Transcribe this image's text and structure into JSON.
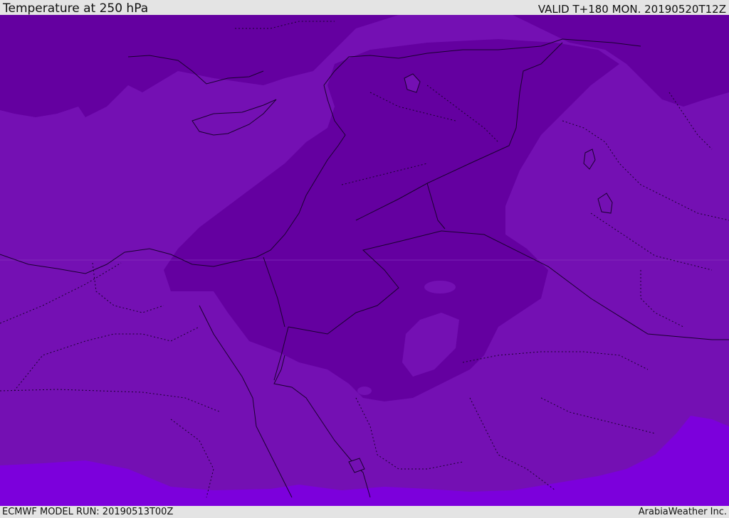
{
  "header": {
    "title": "Temperature at 250 hPa",
    "valid": "VALID T+180 MON. 20190520T12Z"
  },
  "footer": {
    "model_run": "ECMWF MODEL RUN: 20190513T00Z",
    "credit": "ArabiaWeather Inc."
  },
  "colors": {
    "background": "#7410b3",
    "cold": "#6400a0",
    "warm": "#7c00dc",
    "border": "#1a0030"
  }
}
